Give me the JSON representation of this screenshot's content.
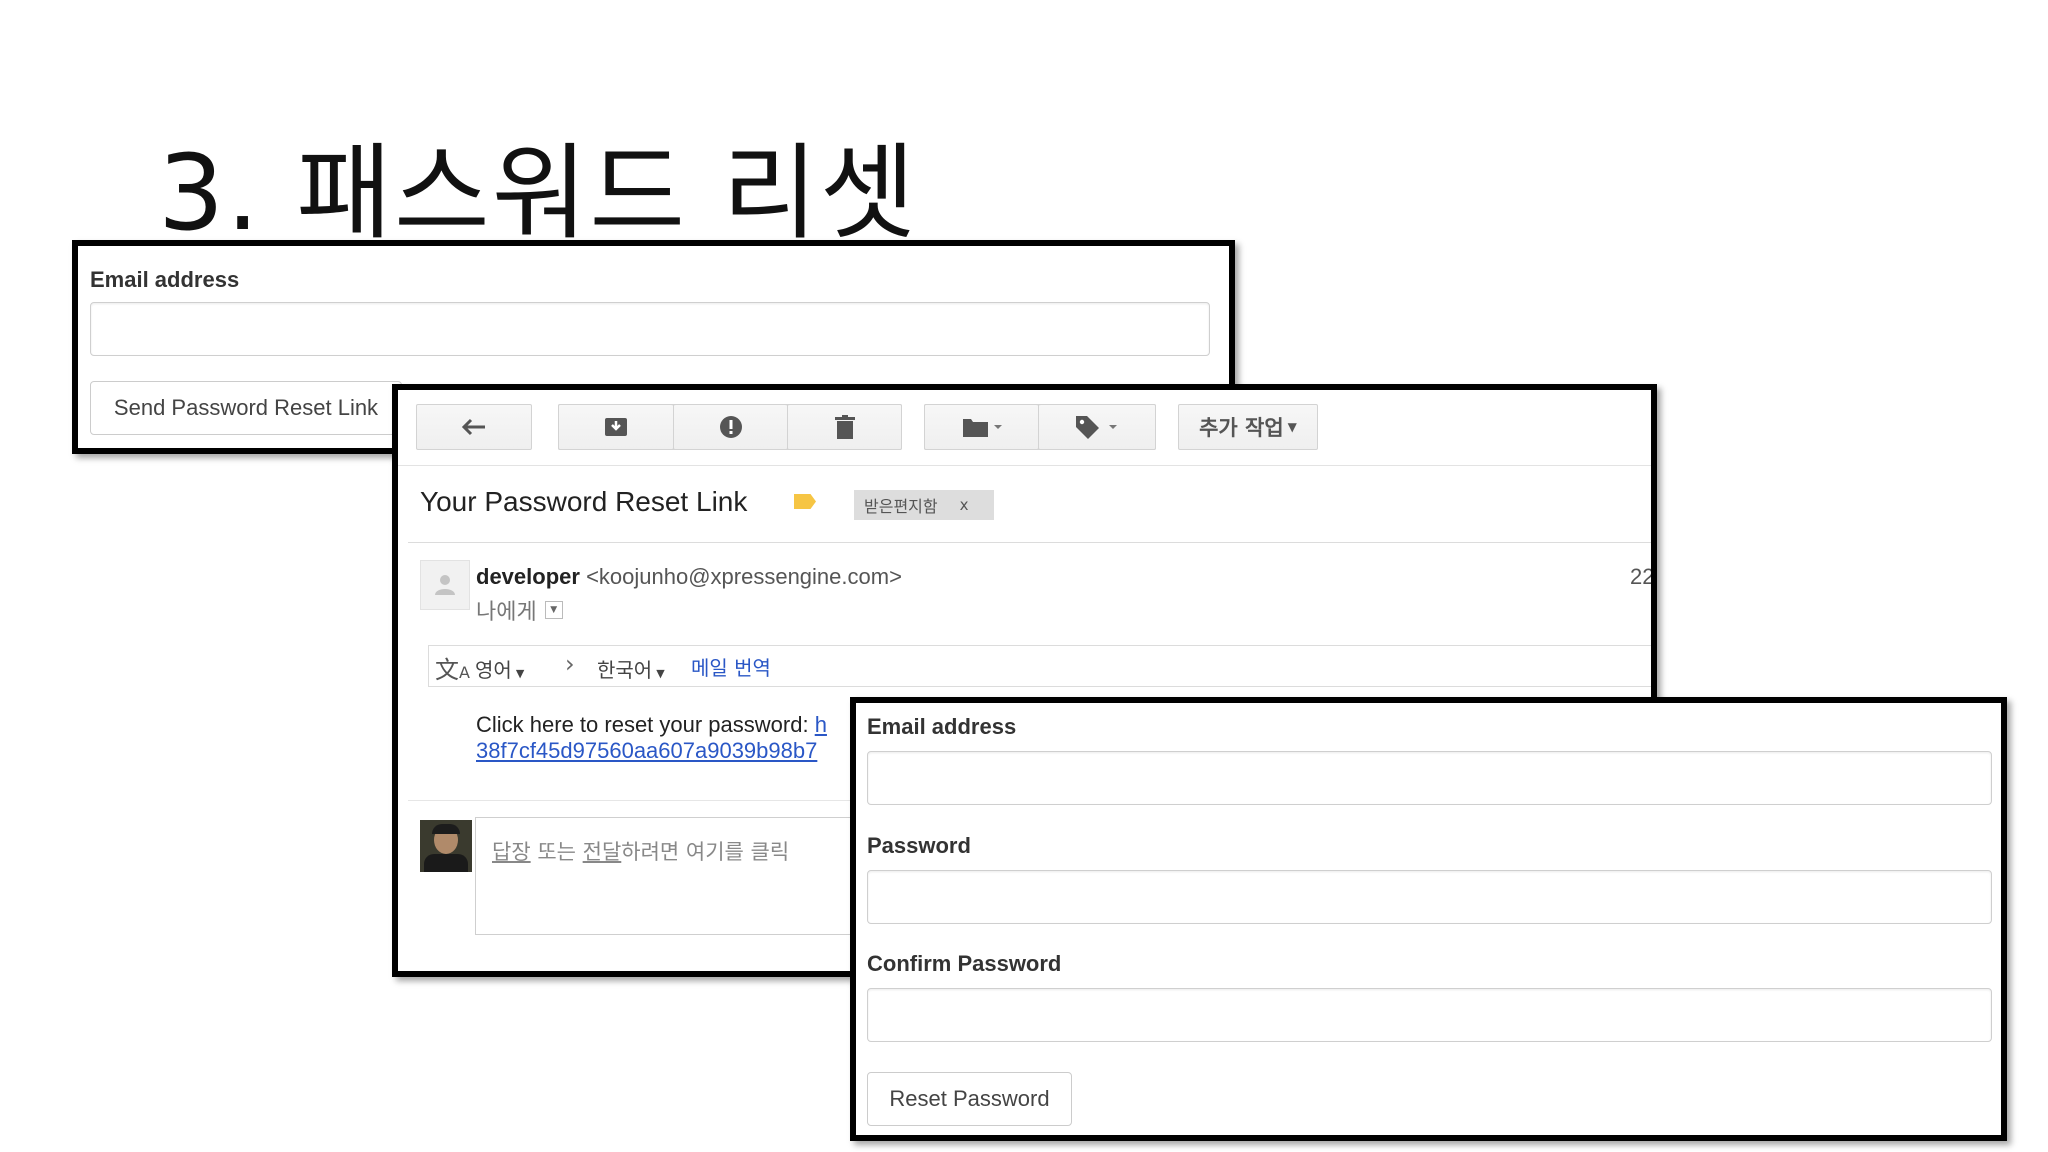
{
  "slide": {
    "title": "3. 패스워드 리셋"
  },
  "form_request": {
    "email_label": "Email address",
    "email_value": "",
    "send_button": "Send Password Reset Link"
  },
  "gmail": {
    "toolbar": {
      "more_actions": "추가 작업"
    },
    "subject": "Your Password Reset Link",
    "label_chip": "받은편지함",
    "label_chip_close": "x",
    "sender_name": "developer",
    "sender_email": "<koojunho@xpressengine.com>",
    "time_partial": "22",
    "to_me": "나에게",
    "translate": {
      "from_lang": "영어",
      "arrow": "›",
      "to_lang": "한국어",
      "translate_link": "메일 번역"
    },
    "body_text": "Click here to reset your password:",
    "body_link_partial": "h",
    "body_link_line2": "38f7cf45d97560aa607a9039b98b7",
    "reply_placeholder_reply": "답장",
    "reply_placeholder_mid": " 또는 ",
    "reply_placeholder_forward": "전달",
    "reply_placeholder_rest": "하려면 여기를 클릭"
  },
  "form_reset": {
    "email_label": "Email address",
    "email_value": "",
    "password_label": "Password",
    "password_value": "",
    "confirm_label": "Confirm Password",
    "confirm_value": "",
    "reset_button": "Reset Password"
  },
  "colors": {
    "link": "#2a57c6",
    "label_chip_bg": "#dddddd",
    "important_marker": "#f6c544"
  }
}
